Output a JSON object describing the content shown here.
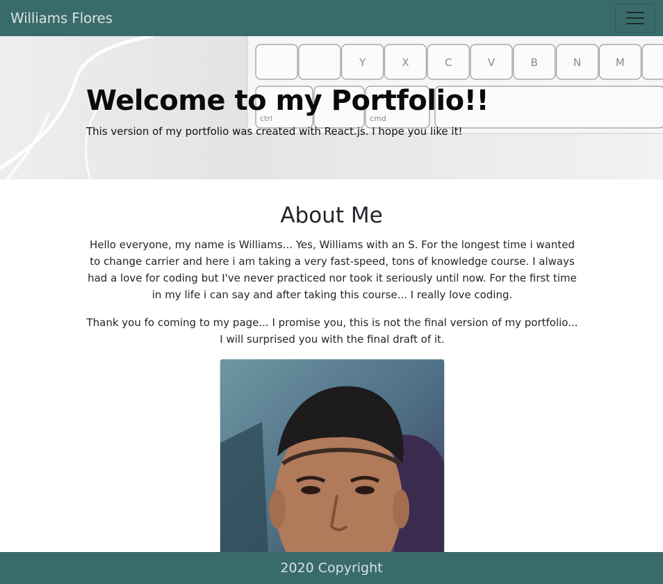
{
  "navbar": {
    "brand": "Williams Flores",
    "toggler_icon": "hamburger-menu-icon"
  },
  "hero": {
    "title": "Welcome to my Portfolio!!",
    "subtitle": "This version of my portfolio was created with React.js. I hope you like it!",
    "keyboard_keys": [
      "Y",
      "X",
      "C",
      "V",
      "B",
      "N",
      "M",
      "ctrl",
      "cmd"
    ]
  },
  "about": {
    "title": "About Me",
    "paragraph1": "Hello everyone, my name is Williams... Yes, Williams with an S. For the longest time i wanted to change carrier and here i am taking a very fast-speed, tons of knowledge course. I always had a love for coding but I've never practiced nor took it seriously until now. For the first time in my life i can say and after taking this course... I really love coding.",
    "paragraph2": "Thank you fo coming to my page... I promise you, this is not the final version of my portfolio... I will surprised you with the final draft of it."
  },
  "footer": {
    "text": "2020 Copyright"
  },
  "colors": {
    "primary": "#3a6b6b",
    "nav_text": "#d6e2e2"
  }
}
